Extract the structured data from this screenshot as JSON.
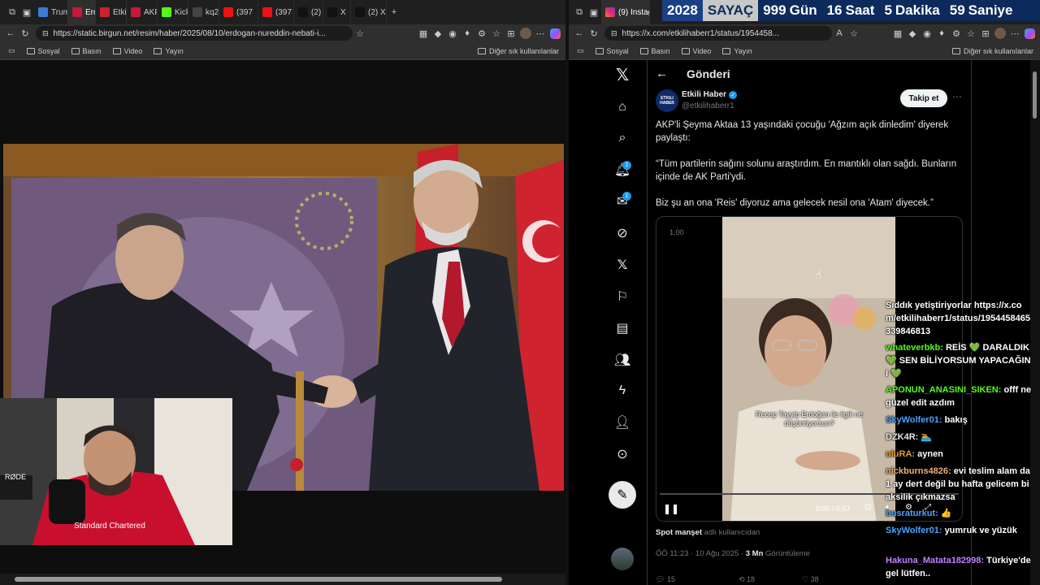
{
  "left": {
    "tabs": [
      "Trum",
      "Erdo",
      "Etkil",
      "AKP",
      "Kick",
      "kq2",
      "(397",
      "(397",
      "(2) X",
      "X",
      "(2) X"
    ],
    "tab_colors": [
      "#3b7bd6",
      "#c9183a",
      "#d0202e",
      "#c9183a",
      "#53fc18",
      "#444",
      "#e11",
      "#e11",
      "#111",
      "#111",
      "#111"
    ],
    "url": "https://static.birgun.net/resim/haber/2025/08/10/erdogan-nureddin-nebati-i...",
    "bookmarks": [
      "Sosyal",
      "Basın",
      "Video",
      "Yayın"
    ],
    "bookmarks_other": "Diğer sık kullanılanlar"
  },
  "right": {
    "tab_title": "(9) Instagram",
    "url": "https://x.com/etkilihaberr1/status/1954458...",
    "bookmarks": [
      "Sosyal",
      "Basın",
      "Video",
      "Yayın"
    ],
    "bookmarks_other": "Diğer sık kullanılanlar"
  },
  "counter": {
    "year": "2028",
    "label": "SAYAÇ",
    "days": "999",
    "days_unit": "Gün",
    "hours": "16",
    "hours_unit": "Saat",
    "minutes": "5",
    "minutes_unit": "Dakika",
    "seconds": "59",
    "seconds_unit": "Saniye"
  },
  "x": {
    "page_title": "Gönderi",
    "author_name": "Etkili Haber",
    "author_handle": "@etkilihaberr1",
    "avatar_text": "ETKILI HABER",
    "follow_label": "Takip et",
    "text1": "AKP'li Şeyma Aktaa 13 yaşındaki çocuğu 'Ağzım açık dinledim' diyerek paylaştı:",
    "text2": "“Tüm partilerin sağını solunu araştırdım. En mantıklı olan sağdı. Bunların içinde de AK Parti'ydi.",
    "text3": "Biz şu an ona 'Reis' diyoruz ama gelecek nesil ona 'Atam' diyecek.”",
    "video_speed": "1.00",
    "video_caption": "Recep Tayyip Erdoğan ile ilgili ne düşünüyorsun?",
    "video_time": "0:00 / 0:57",
    "video_progress": 0.0,
    "source_user": "Spot manşet",
    "source_suffix": "adlı kullanıcıdan",
    "timestamp": "ÖÖ 11:23 · 10 Ağu 2025 ·",
    "views": "3 Mn",
    "views_label": "Görüntüleme",
    "stats": [
      "15",
      "18",
      "38"
    ],
    "badge_notifications": "1",
    "badge_messages": "1"
  },
  "chat": [
    {
      "user": "",
      "text": "Sıddık yetiştiriyorlar https://x.com/etkilihaberr1/status/1954458465339846813",
      "color": "#ffffff"
    },
    {
      "user": "whateverbkb",
      "text": "REİS 💚 DARALDIK 💚 SEN BİLİYORSUM YAPACAĞINI 💚",
      "color": "#53fc18"
    },
    {
      "user": "APONUN_ANASINI_SIKEN",
      "text": "offf ne güzel edit azdım",
      "color": "#53fc18"
    },
    {
      "user": "SkyWolfer01",
      "text": "bakış",
      "color": "#4aa3ff"
    },
    {
      "user": "DZK4R",
      "text": "🏊",
      "color": "#e8e8e8"
    },
    {
      "user": "uluRA",
      "text": "aynen",
      "color": "#e0a030"
    },
    {
      "user": "nickburns4826",
      "text": "evi teslim alam da 1 ay dert değil bu hafta gelicem bi aksilik çıkmazsa",
      "color": "#f0b070"
    },
    {
      "user": "busraturkut",
      "text": "👍",
      "color": "#4aa3ff"
    },
    {
      "user": "SkyWolfer01",
      "text": "yumruk ve yüzük",
      "color": "#4aa3ff"
    },
    {
      "user": "Hakuna_Matata182998",
      "text": "Türkiye'de gel lütfen..",
      "color": "#c080ff"
    }
  ]
}
